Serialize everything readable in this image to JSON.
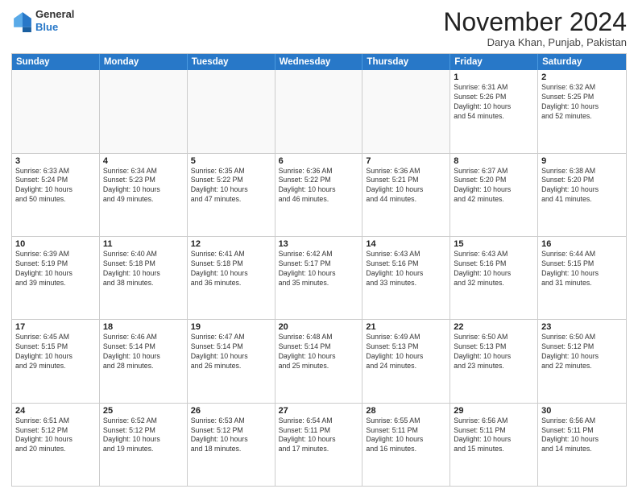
{
  "header": {
    "logo_general": "General",
    "logo_blue": "Blue",
    "month": "November 2024",
    "location": "Darya Khan, Punjab, Pakistan"
  },
  "days": [
    "Sunday",
    "Monday",
    "Tuesday",
    "Wednesday",
    "Thursday",
    "Friday",
    "Saturday"
  ],
  "rows": [
    [
      {
        "day": "",
        "detail": "",
        "empty": true
      },
      {
        "day": "",
        "detail": "",
        "empty": true
      },
      {
        "day": "",
        "detail": "",
        "empty": true
      },
      {
        "day": "",
        "detail": "",
        "empty": true
      },
      {
        "day": "",
        "detail": "",
        "empty": true
      },
      {
        "day": "1",
        "detail": "Sunrise: 6:31 AM\nSunset: 5:26 PM\nDaylight: 10 hours\nand 54 minutes.",
        "empty": false
      },
      {
        "day": "2",
        "detail": "Sunrise: 6:32 AM\nSunset: 5:25 PM\nDaylight: 10 hours\nand 52 minutes.",
        "empty": false
      }
    ],
    [
      {
        "day": "3",
        "detail": "Sunrise: 6:33 AM\nSunset: 5:24 PM\nDaylight: 10 hours\nand 50 minutes.",
        "empty": false
      },
      {
        "day": "4",
        "detail": "Sunrise: 6:34 AM\nSunset: 5:23 PM\nDaylight: 10 hours\nand 49 minutes.",
        "empty": false
      },
      {
        "day": "5",
        "detail": "Sunrise: 6:35 AM\nSunset: 5:22 PM\nDaylight: 10 hours\nand 47 minutes.",
        "empty": false
      },
      {
        "day": "6",
        "detail": "Sunrise: 6:36 AM\nSunset: 5:22 PM\nDaylight: 10 hours\nand 46 minutes.",
        "empty": false
      },
      {
        "day": "7",
        "detail": "Sunrise: 6:36 AM\nSunset: 5:21 PM\nDaylight: 10 hours\nand 44 minutes.",
        "empty": false
      },
      {
        "day": "8",
        "detail": "Sunrise: 6:37 AM\nSunset: 5:20 PM\nDaylight: 10 hours\nand 42 minutes.",
        "empty": false
      },
      {
        "day": "9",
        "detail": "Sunrise: 6:38 AM\nSunset: 5:20 PM\nDaylight: 10 hours\nand 41 minutes.",
        "empty": false
      }
    ],
    [
      {
        "day": "10",
        "detail": "Sunrise: 6:39 AM\nSunset: 5:19 PM\nDaylight: 10 hours\nand 39 minutes.",
        "empty": false
      },
      {
        "day": "11",
        "detail": "Sunrise: 6:40 AM\nSunset: 5:18 PM\nDaylight: 10 hours\nand 38 minutes.",
        "empty": false
      },
      {
        "day": "12",
        "detail": "Sunrise: 6:41 AM\nSunset: 5:18 PM\nDaylight: 10 hours\nand 36 minutes.",
        "empty": false
      },
      {
        "day": "13",
        "detail": "Sunrise: 6:42 AM\nSunset: 5:17 PM\nDaylight: 10 hours\nand 35 minutes.",
        "empty": false
      },
      {
        "day": "14",
        "detail": "Sunrise: 6:43 AM\nSunset: 5:16 PM\nDaylight: 10 hours\nand 33 minutes.",
        "empty": false
      },
      {
        "day": "15",
        "detail": "Sunrise: 6:43 AM\nSunset: 5:16 PM\nDaylight: 10 hours\nand 32 minutes.",
        "empty": false
      },
      {
        "day": "16",
        "detail": "Sunrise: 6:44 AM\nSunset: 5:15 PM\nDaylight: 10 hours\nand 31 minutes.",
        "empty": false
      }
    ],
    [
      {
        "day": "17",
        "detail": "Sunrise: 6:45 AM\nSunset: 5:15 PM\nDaylight: 10 hours\nand 29 minutes.",
        "empty": false
      },
      {
        "day": "18",
        "detail": "Sunrise: 6:46 AM\nSunset: 5:14 PM\nDaylight: 10 hours\nand 28 minutes.",
        "empty": false
      },
      {
        "day": "19",
        "detail": "Sunrise: 6:47 AM\nSunset: 5:14 PM\nDaylight: 10 hours\nand 26 minutes.",
        "empty": false
      },
      {
        "day": "20",
        "detail": "Sunrise: 6:48 AM\nSunset: 5:14 PM\nDaylight: 10 hours\nand 25 minutes.",
        "empty": false
      },
      {
        "day": "21",
        "detail": "Sunrise: 6:49 AM\nSunset: 5:13 PM\nDaylight: 10 hours\nand 24 minutes.",
        "empty": false
      },
      {
        "day": "22",
        "detail": "Sunrise: 6:50 AM\nSunset: 5:13 PM\nDaylight: 10 hours\nand 23 minutes.",
        "empty": false
      },
      {
        "day": "23",
        "detail": "Sunrise: 6:50 AM\nSunset: 5:12 PM\nDaylight: 10 hours\nand 22 minutes.",
        "empty": false
      }
    ],
    [
      {
        "day": "24",
        "detail": "Sunrise: 6:51 AM\nSunset: 5:12 PM\nDaylight: 10 hours\nand 20 minutes.",
        "empty": false
      },
      {
        "day": "25",
        "detail": "Sunrise: 6:52 AM\nSunset: 5:12 PM\nDaylight: 10 hours\nand 19 minutes.",
        "empty": false
      },
      {
        "day": "26",
        "detail": "Sunrise: 6:53 AM\nSunset: 5:12 PM\nDaylight: 10 hours\nand 18 minutes.",
        "empty": false
      },
      {
        "day": "27",
        "detail": "Sunrise: 6:54 AM\nSunset: 5:11 PM\nDaylight: 10 hours\nand 17 minutes.",
        "empty": false
      },
      {
        "day": "28",
        "detail": "Sunrise: 6:55 AM\nSunset: 5:11 PM\nDaylight: 10 hours\nand 16 minutes.",
        "empty": false
      },
      {
        "day": "29",
        "detail": "Sunrise: 6:56 AM\nSunset: 5:11 PM\nDaylight: 10 hours\nand 15 minutes.",
        "empty": false
      },
      {
        "day": "30",
        "detail": "Sunrise: 6:56 AM\nSunset: 5:11 PM\nDaylight: 10 hours\nand 14 minutes.",
        "empty": false
      }
    ]
  ]
}
